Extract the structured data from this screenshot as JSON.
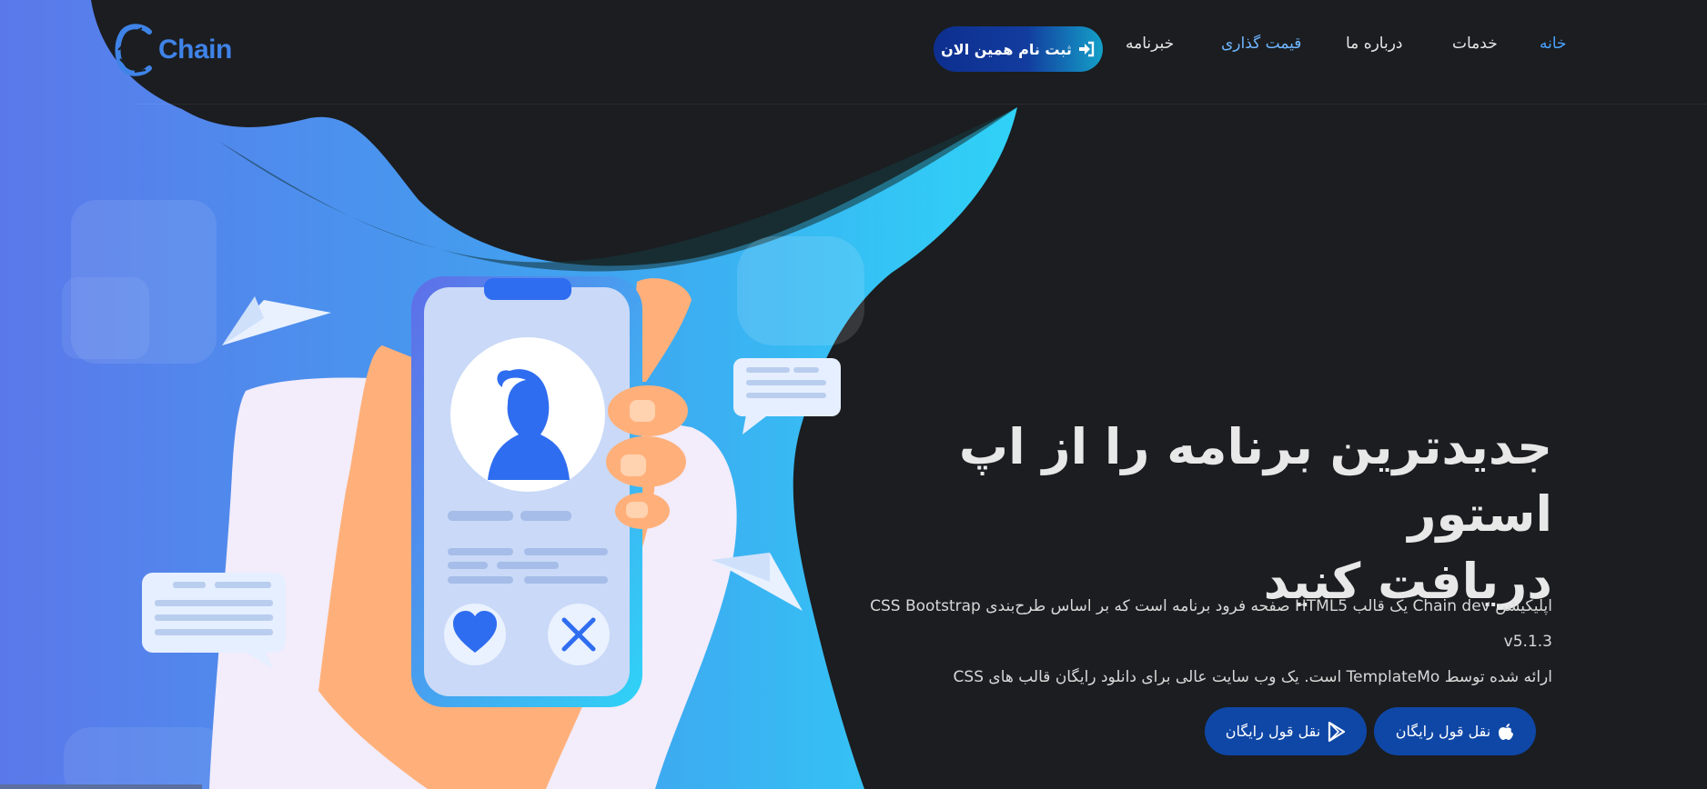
{
  "brand": {
    "name": "Chain",
    "logo_icon": "chain-link-icon"
  },
  "nav": {
    "items": [
      {
        "label": "خانه",
        "state": "active"
      },
      {
        "label": "خدمات",
        "state": "normal"
      },
      {
        "label": "درباره ما",
        "state": "normal"
      },
      {
        "label": "قیمت گذاری",
        "state": "highlighted"
      },
      {
        "label": "خبرنامه",
        "state": "normal"
      }
    ],
    "signup": {
      "label": "ثبت نام همین الان",
      "icon": "sign-in-icon"
    }
  },
  "hero": {
    "title_line1": "جدیدترین برنامه را از اپ استور",
    "title_line2": "دریافت کنید",
    "desc_line1": "اپلیکیشن Chain dev یک قالب HTML5 صفحه فرود برنامه است که بر اساس طرح‌بندی CSS Bootstrap v5.1.3",
    "desc_line2": "ارائه شده توسط TemplateMo است. یک وب سایت عالی برای دانلود رایگان قالب های CSS",
    "buttons": [
      {
        "label": "نقل قول رایگان",
        "icon": "apple-icon"
      },
      {
        "label": "نقل قول رایگان",
        "icon": "google-play-icon"
      }
    ]
  },
  "illustration": {
    "description_icons": [
      "phone-icon",
      "user-avatar-icon",
      "heart-icon",
      "close-icon",
      "paper-plane-icon",
      "chat-bubble-icon"
    ]
  },
  "colors": {
    "background": "#1b1d20",
    "accent_blue": "#3f83e8",
    "button_blue": "#0f47a6",
    "cyan": "#2fd0f5"
  }
}
